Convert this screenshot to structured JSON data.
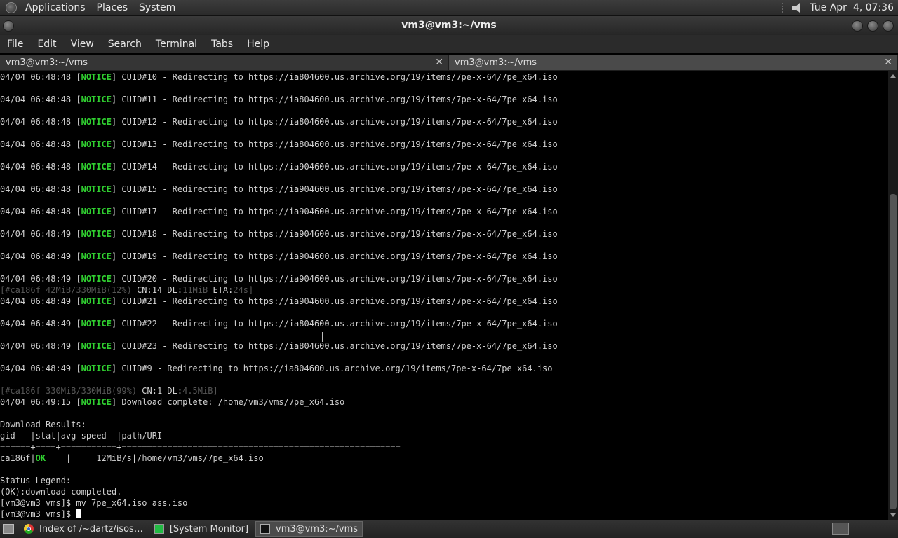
{
  "top_panel": {
    "menus": [
      "Applications",
      "Places",
      "System"
    ],
    "clock": "Tue Apr  4, 07:36"
  },
  "window": {
    "title": "vm3@vm3:~/vms"
  },
  "menubar": [
    "File",
    "Edit",
    "View",
    "Search",
    "Terminal",
    "Tabs",
    "Help"
  ],
  "tabs": [
    {
      "label": "vm3@vm3:~/vms",
      "close": "✕"
    },
    {
      "label": "vm3@vm3:~/vms",
      "close": "✕"
    }
  ],
  "terminal": {
    "redirects": [
      {
        "ts": "04/04 06:48:48",
        "cuid": "CUID#10",
        "host": "ia804600",
        "spacing": "normal"
      },
      {
        "ts": "04/04 06:48:48",
        "cuid": "CUID#11",
        "host": "ia804600",
        "spacing": "normal"
      },
      {
        "ts": "04/04 06:48:48",
        "cuid": "CUID#12",
        "host": "ia804600",
        "spacing": "normal"
      },
      {
        "ts": "04/04 06:48:48",
        "cuid": "CUID#13",
        "host": "ia804600",
        "spacing": "normal"
      },
      {
        "ts": "04/04 06:48:48",
        "cuid": "CUID#14",
        "host": "ia904600",
        "spacing": "normal"
      },
      {
        "ts": "04/04 06:48:48",
        "cuid": "CUID#15",
        "host": "ia904600",
        "spacing": "normal"
      },
      {
        "ts": "04/04 06:48:48",
        "cuid": "CUID#17",
        "host": "ia904600",
        "spacing": "normal"
      },
      {
        "ts": "04/04 06:48:49",
        "cuid": "CUID#18",
        "host": "ia904600",
        "spacing": "normal"
      },
      {
        "ts": "04/04 06:48:49",
        "cuid": "CUID#19",
        "host": "ia904600",
        "spacing": "normal"
      },
      {
        "ts": "04/04 06:48:49",
        "cuid": "CUID#20",
        "host": "ia904600",
        "spacing": "normal"
      }
    ],
    "notice_tag": "NOTICE",
    "redirect_path": ".us.archive.org/19/items/7pe-x-64/7pe_x64.iso",
    "line_texts": [
      "04/04 06:48:48 [NOTICE] CUID#10 - Redirecting to https://ia804600.us.archive.org/19/items/7pe-x-64/7pe_x64.iso",
      "04/04 06:48:48 [NOTICE] CUID#11 - Redirecting to https://ia804600.us.archive.org/19/items/7pe-x-64/7pe_x64.iso",
      "04/04 06:48:48 [NOTICE] CUID#12 - Redirecting to https://ia804600.us.archive.org/19/items/7pe-x-64/7pe_x64.iso",
      "04/04 06:48:48 [NOTICE] CUID#13 - Redirecting to https://ia804600.us.archive.org/19/items/7pe-x-64/7pe_x64.iso",
      "04/04 06:48:48 [NOTICE] CUID#14 - Redirecting to https://ia904600.us.archive.org/19/items/7pe-x-64/7pe_x64.iso",
      "04/04 06:48:48 [NOTICE] CUID#15 - Redirecting to https://ia904600.us.archive.org/19/items/7pe-x-64/7pe_x64.iso",
      "04/04 06:48:48 [NOTICE] CUID#17 - Redirecting to https://ia904600.us.archive.org/19/items/7pe-x-64/7pe_x64.iso",
      "04/04 06:48:49 [NOTICE] CUID#18 - Redirecting to https://ia904600.us.archive.org/19/items/7pe-x-64/7pe_x64.iso",
      "04/04 06:48:49 [NOTICE] CUID#19 - Redirecting to https://ia904600.us.archive.org/19/items/7pe-x-64/7pe_x64.iso",
      "04/04 06:48:49 [NOTICE] CUID#20 - Redirecting to https://ia904600.us.archive.org/19/items/7pe-x-64/7pe_x64.iso"
    ],
    "progress1": {
      "prefix": "[#ca186f 42MiB/330MiB",
      "pct": "(12%)",
      "mid": " CN:14 DL:",
      "speed": "11MiB",
      "eta_label": " ETA:",
      "eta": "24s",
      "suffix": "]"
    },
    "more_lines": [
      "04/04 06:48:49 [NOTICE] CUID#21 - Redirecting to https://ia904600.us.archive.org/19/items/7pe-x-64/7pe_x64.iso",
      "04/04 06:48:49 [NOTICE] CUID#22 - Redirecting to https://ia804600.us.archive.org/19/items/7pe-x-64/7pe_x64.iso",
      "04/04 06:48:49 [NOTICE] CUID#23 - Redirecting to https://ia804600.us.archive.org/19/items/7pe-x-64/7pe_x64.iso",
      "04/04 06:48:49 [NOTICE] CUID#9 - Redirecting to https://ia804600.us.archive.org/19/items/7pe-x-64/7pe_x64.iso"
    ],
    "progress2": {
      "prefix": "[#ca186f 330MiB/330MiB",
      "pct": "(99%)",
      "mid": " CN:1 DL:",
      "speed": "4.5MiB",
      "suffix": "]"
    },
    "complete_line": "04/04 06:49:15 [NOTICE] Download complete: /home/vm3/vms/7pe_x64.iso",
    "results_title": "Download Results:",
    "results_header": "gid   |stat|avg speed  |path/URI",
    "results_sep": "======+====+===========+=======================================================",
    "result_row": {
      "gid": "ca186f",
      "stat": "OK",
      "rest": "    |     12MiB/s|/home/vm3/vms/7pe_x64.iso"
    },
    "legend_title": "Status Legend:",
    "legend_ok": "(OK):download completed.",
    "cmd_line": "[vm3@vm3 vms]$ mv 7pe_x64.iso ass.iso",
    "prompt": "[vm3@vm3 vms]$ "
  },
  "taskbar": {
    "items": [
      {
        "label": "Index of /~dartz/isos…",
        "icon": "chrome-icon",
        "active": false
      },
      {
        "label": "[System Monitor]",
        "icon": "system-monitor-icon",
        "active": false
      },
      {
        "label": "vm3@vm3:~/vms",
        "icon": "terminal-icon",
        "active": true
      }
    ]
  }
}
